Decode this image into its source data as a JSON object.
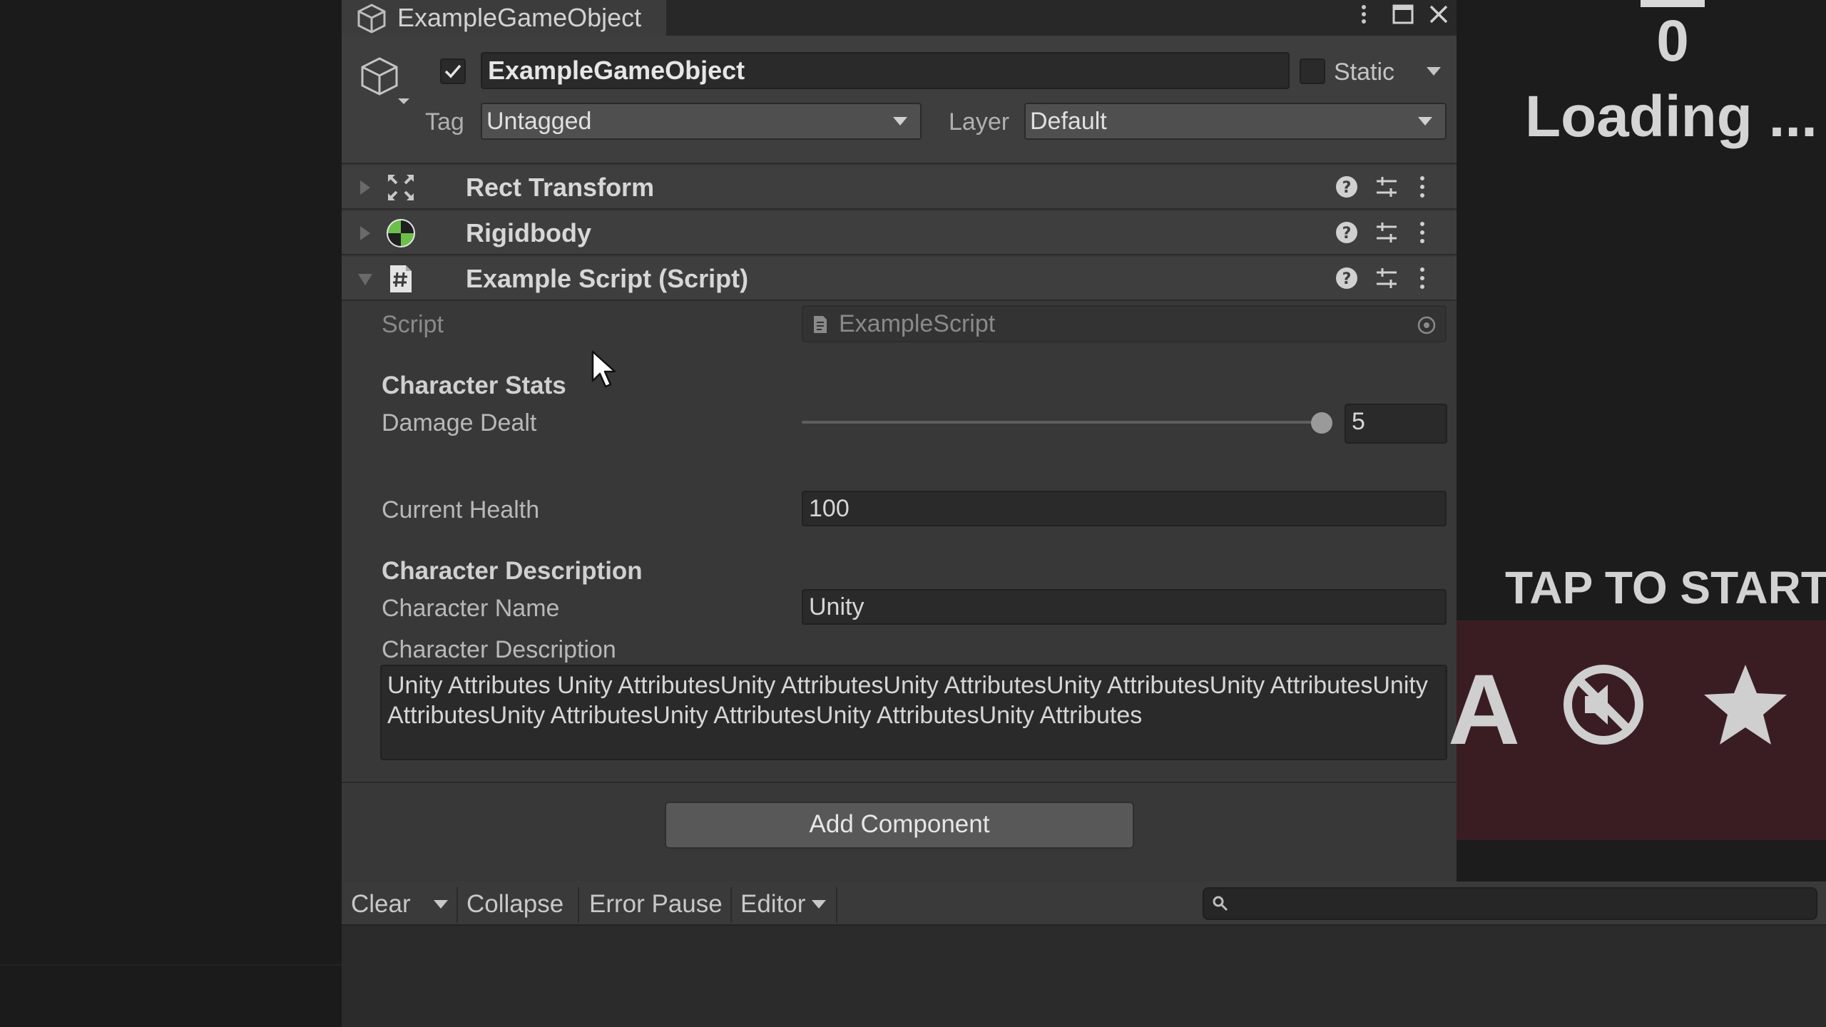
{
  "inspector": {
    "tab_title": "ExampleGameObject",
    "object_name": "ExampleGameObject",
    "active": true,
    "static_label": "Static",
    "static": false,
    "tag_label": "Tag",
    "tag_value": "Untagged",
    "layer_label": "Layer",
    "layer_value": "Default"
  },
  "components": [
    {
      "title": "Rect Transform",
      "icon": "rect-transform-icon",
      "expanded": false
    },
    {
      "title": "Rigidbody",
      "icon": "rigidbody-icon",
      "expanded": false
    },
    {
      "title": "Example Script (Script)",
      "icon": "csharp-script-icon",
      "expanded": true
    }
  ],
  "script": {
    "script_label": "Script",
    "script_value": "ExampleScript",
    "character_stats_header": "Character Stats",
    "damage_label": "Damage Dealt",
    "damage_value": "5",
    "damage_slider_fraction": 0.97,
    "current_health_label": "Current Health",
    "current_health_value": "100",
    "character_description_header": "Character Description",
    "character_name_label": "Character Name",
    "character_name_value": "Unity",
    "character_description_label": "Character Description",
    "character_description_value": "Unity Attributes Unity AttributesUnity AttributesUnity AttributesUnity AttributesUnity AttributesUnity AttributesUnity AttributesUnity AttributesUnity AttributesUnity Attributes"
  },
  "add_component_label": "Add Component",
  "console": {
    "clear_label": "Clear",
    "collapse_label": "Collapse",
    "error_pause_label": "Error Pause",
    "editor_label": "Editor",
    "search_value": ""
  },
  "game": {
    "score": "0",
    "loading_text": "Loading ...",
    "tap_to_start": "TAP TO START",
    "glyph": "A",
    "panel_color": "#3a1d22"
  },
  "colors": {
    "inspector_bg": "#383838",
    "header_bg": "#3e3e3e",
    "field_bg": "#2a2a2a",
    "rigidbody_green": "#6cc04a"
  }
}
